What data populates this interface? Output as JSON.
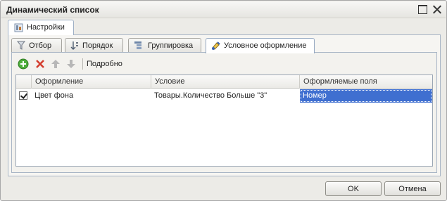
{
  "window": {
    "title": "Динамический список"
  },
  "outer_tab": {
    "label": "Настройки",
    "icon": "settings-icon"
  },
  "inner_tabs": [
    {
      "label": "Отбор",
      "icon": "filter-icon",
      "active": false
    },
    {
      "label": "Порядок",
      "icon": "sort-icon",
      "active": false
    },
    {
      "label": "Группировка",
      "icon": "grouping-icon",
      "active": false
    },
    {
      "label": "Условное оформление",
      "icon": "conditional-format-icon",
      "active": true
    }
  ],
  "toolbar": {
    "add_icon": "add-icon",
    "delete_icon": "delete-icon",
    "move_up_icon": "arrow-up-icon",
    "move_down_icon": "arrow-down-icon",
    "details_label": "Подробно"
  },
  "table": {
    "columns": [
      "Оформление",
      "Условие",
      "Оформляемые поля"
    ],
    "rows": [
      {
        "checked": true,
        "appearance": "Цвет фона",
        "condition": "Товары.Количество Больше \"3\"",
        "fields": "Номер"
      }
    ]
  },
  "buttons": {
    "ok": "OK",
    "cancel": "Отмена"
  },
  "colors": {
    "selection": "#3f6fd0",
    "window_bg": "#ecebe7"
  }
}
